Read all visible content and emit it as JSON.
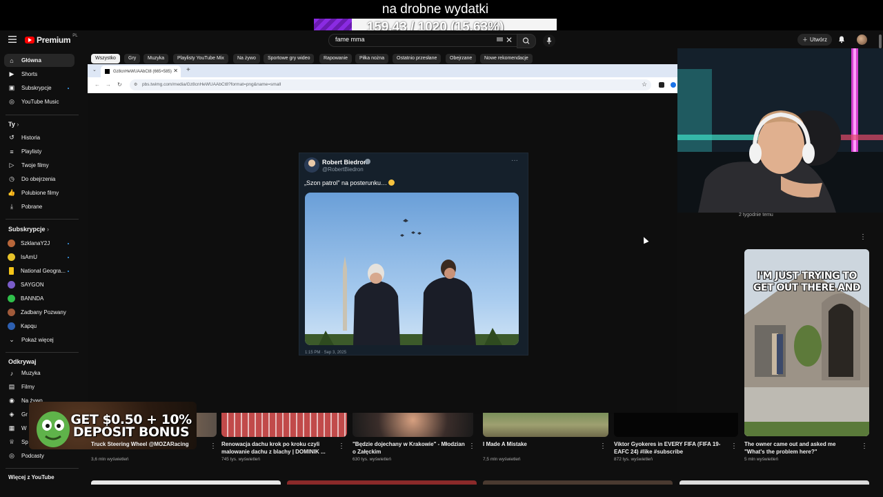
{
  "overlay": {
    "donation_title": "na drobne wydatki",
    "goal_text": "159.43 / 1020 (15.63%)",
    "goal_fraction": 0.1563,
    "promo_text": "GET $0.50 + 10% DEPOSIT BONUS"
  },
  "masthead": {
    "logo_text": "Premium",
    "logo_region": "PL",
    "search_value": "fame mma",
    "create_label": "Utwórz"
  },
  "sidebar": {
    "main": [
      {
        "label": "Główna",
        "icon": "home-icon"
      },
      {
        "label": "Shorts",
        "icon": "shorts-icon"
      },
      {
        "label": "Subskrypcje",
        "icon": "subscriptions-icon"
      },
      {
        "label": "YouTube Music",
        "icon": "music-icon"
      }
    ],
    "you_header": "Ty",
    "you": [
      {
        "label": "Historia",
        "icon": "history-icon"
      },
      {
        "label": "Playlisty",
        "icon": "playlist-icon"
      },
      {
        "label": "Twoje filmy",
        "icon": "video-icon"
      },
      {
        "label": "Do obejrzenia",
        "icon": "clock-icon"
      },
      {
        "label": "Polubione filmy",
        "icon": "like-icon"
      },
      {
        "label": "Pobrane",
        "icon": "download-icon"
      }
    ],
    "subs_header": "Subskrypcje",
    "subs": [
      {
        "label": "SzklanaY2J",
        "color": "#b8663a"
      },
      {
        "label": "IsAmU",
        "color": "#e6c229"
      },
      {
        "label": "National Geogra...",
        "color": "#f5c518"
      },
      {
        "label": "SAYGON",
        "color": "#7a5cc9"
      },
      {
        "label": "BANNDA",
        "color": "#2fbf4a"
      },
      {
        "label": "Zadbany Pozwany",
        "color": "#a05a3a"
      },
      {
        "label": "Kapqu",
        "color": "#2d5fb0"
      },
      {
        "label": "Pokaż więcej",
        "color": ""
      }
    ],
    "explore_header": "Odkrywaj",
    "explore": [
      {
        "label": "Muzyka",
        "icon": "music-note-icon"
      },
      {
        "label": "Filmy",
        "icon": "film-icon"
      },
      {
        "label": "Na żywo",
        "icon": "live-icon"
      },
      {
        "label": "Gr",
        "icon": "gaming-icon"
      },
      {
        "label": "W",
        "icon": "news-icon"
      },
      {
        "label": "Sp",
        "icon": "trophy-icon"
      },
      {
        "label": "Podcasty",
        "icon": "podcast-icon"
      }
    ],
    "more_header": "Więcej z YouTube"
  },
  "chips": [
    "Wszystko",
    "Gry",
    "Muzyka",
    "Playlisty YouTube Mix",
    "Na żywo",
    "Sportowe gry wideo",
    "Rapowanie",
    "Piłka nożna",
    "Ostatnio przesłane",
    "Obejrzane",
    "Nowe rekomendacje"
  ],
  "browser": {
    "tab_title": "Gz8cnHeWUAAbCt8 (665×585)",
    "url": "pbs.twimg.com/media/Gz8cnHeWUAAbCt8?format=png&name=small"
  },
  "tweet": {
    "name": "Robert Biedroń",
    "handle": "@RobertBiedron",
    "text": "„Szon patrol” na posterunku…",
    "footer": "1:15 PM · Sep 3, 2025"
  },
  "right": {
    "time_ago": "2 tygodnie temu",
    "short_caption": "I'M JUST TRYING TO GET OUT THERE AND"
  },
  "videos": [
    {
      "title": "Truck Steering Wheel @MOZARacing",
      "meta": "3,6 mln wyświetleń"
    },
    {
      "title": "Renowacja dachu krok po kroku czyli malowanie dachu z blachy | DOMINIK ...",
      "meta": "745 tys. wyświetleń"
    },
    {
      "title": "\"Będzie dojechany w Krakowie\" - Młodzian o Załęckim",
      "meta": "630 tys. wyświetleń"
    },
    {
      "title": "I Made A Mistake",
      "meta": "7,5 mln wyświetleń"
    },
    {
      "title": "Viktor Gyokeres in EVERY FIFA (FIFA 19-EAFC 24) #like #subscribe",
      "meta": "872 tys. wyświetleń"
    },
    {
      "title": "The owner came out and asked me \"What's the problem here?\"",
      "meta": "5 mln wyświetleń"
    }
  ]
}
